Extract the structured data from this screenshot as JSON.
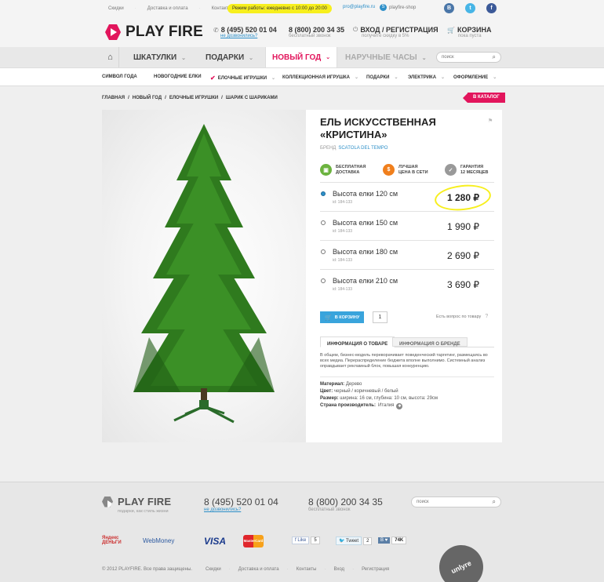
{
  "colors": {
    "accent": "#e2155c",
    "link": "#2d8fc8",
    "highlight": "#f7ef1d",
    "cart_btn": "#39a4dc"
  },
  "topbar": {
    "links": [
      "Скидки",
      "Доставка и оплата",
      "Контакты"
    ],
    "hours": "Режим работы: ежедневно с 10:00 до 20:00",
    "email": "pro@playfire.ru",
    "skype": "playfire-shop",
    "socials": [
      "vkontakte-icon",
      "twitter-icon",
      "facebook-icon"
    ]
  },
  "header": {
    "logo": "PLAY FIRE",
    "phone1": "8 (495) 520 01 04",
    "phone1_sub": "не дозвонились?",
    "phone2": "8 (800) 200 34 35",
    "phone2_sub": "бесплатный звонок",
    "login": "ВХОД / РЕГИСТРАЦИЯ",
    "login_sub": "получите скидку в 5%",
    "cart": "КОРЗИНА",
    "cart_sub": "пока пуста"
  },
  "nav": {
    "items": [
      "ШКАТУЛКИ",
      "ПОДАРКИ",
      "НОВЫЙ ГОД",
      "НАРУЧНЫЕ ЧАСЫ"
    ],
    "search_placeholder": "поиск"
  },
  "subnav": {
    "items": [
      "СИМВОЛ ГОДА",
      "НОВОГОДНИЕ ЕЛКИ",
      "ЕЛОЧНЫЕ ИГРУШКИ",
      "КОЛЛЕКЦИОННАЯ ИГРУШКА",
      "ПОДАРКИ",
      "ЭЛЕКТРИКА",
      "ОФОРМЛЕНИЕ"
    ]
  },
  "breadcrumb": {
    "items": [
      "ГЛАВНАЯ",
      "НОВЫЙ ГОД",
      "ЕЛОЧНЫЕ ИГРУШКИ",
      "ШАРИК С ШАРИКАМИ"
    ],
    "catalog_btn": "В КАТАЛОГ"
  },
  "product": {
    "title_line1": "ЕЛЬ ИСКУССТВЕННАЯ",
    "title_line2": "«КРИСТИНА»",
    "brand_label": "БРЕНД",
    "brand": "SCATOLA DEL TEMPO",
    "features": [
      {
        "line1": "БЕСПЛАТНАЯ",
        "line2": "ДОСТАВКА",
        "icon": "truck-icon",
        "color": "#6cb33f"
      },
      {
        "line1": "ЛУЧШАЯ",
        "line2": "ЦЕНА В СЕТИ",
        "icon": "dollar-icon",
        "color": "#f07f1c"
      },
      {
        "line1": "ГАРАНТИЯ",
        "line2": "12 МЕСЯЦЕВ",
        "icon": "check-badge-icon",
        "color": "#999999"
      }
    ],
    "options": [
      {
        "label": "Высота елки 120 см",
        "id": "id: 184-133",
        "price": "1 280 ₽",
        "selected": true
      },
      {
        "label": "Высота елки 150 см",
        "id": "id: 184-133",
        "price": "1 990 ₽",
        "selected": false
      },
      {
        "label": "Высота елки 180 см",
        "id": "id: 184-133",
        "price": "2 690 ₽",
        "selected": false
      },
      {
        "label": "Высота елки 210 см",
        "id": "id: 184-133",
        "price": "3 690 ₽",
        "selected": false
      }
    ],
    "cart_button": "В КОРЗИНУ",
    "quantity": "1",
    "question": "Есть вопрос по товару",
    "tabs": [
      "ИНФОРМАЦИЯ О ТОВАРЕ",
      "ИНФОРМАЦИЯ О БРЕНДЕ"
    ],
    "description": "В общем, бизнес-модель переворачивает поведенческий таргетинг, размещаясь во всех медиа. Перераспределение бюджета вполне выполнимо. Системный анализ оправдывает рекламный блок, повышая конкуренцию.",
    "attrs": [
      {
        "k": "Материал:",
        "v": "Дерево"
      },
      {
        "k": "Цвет:",
        "v": "черный / коричневый / белый"
      },
      {
        "k": "Размер:",
        "v": "ширина: 16 см, глубина: 10 см, высота: 29см"
      },
      {
        "k": "Страна производитель:",
        "v": "Италия"
      }
    ]
  },
  "footer": {
    "logo": "PLAY FIRE",
    "slogan": "подарки, как стиль жизни",
    "phone1": "8 (495) 520 01 04",
    "phone1_sub": "не дозвонились?",
    "phone2": "8 (800) 200 34 35",
    "phone2_sub": "бесплатный звонок",
    "search_placeholder": "поиск",
    "payments": [
      "Яндекс ДЕНЬГИ",
      "WebMoney",
      "VISA",
      "MasterCard"
    ],
    "like_fb": "Like",
    "like_fb_count": "5",
    "tweet": "Tweet",
    "tweet_count": "2",
    "vk_count": "74K",
    "copyright": "© 2012 PLAYFIRE. Все права защищены.",
    "links": [
      "Скидки",
      "Доставка и оплата",
      "Контакты",
      "Вход",
      "Регистрация"
    ],
    "sticker": "unlyre"
  }
}
